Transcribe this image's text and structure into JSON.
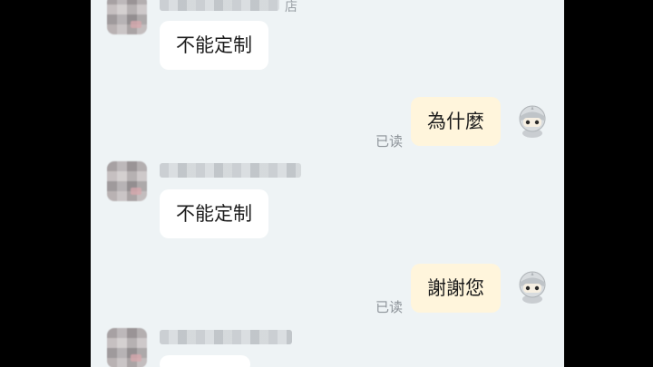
{
  "messages": [
    {
      "side": "left",
      "text": "不能定制",
      "name_suffix": "店"
    },
    {
      "side": "right",
      "text": "為什麼",
      "status": "已读"
    },
    {
      "side": "left",
      "text": "不能定制"
    },
    {
      "side": "right",
      "text": "謝謝您",
      "status": "已读"
    }
  ],
  "icons": {
    "contact_avatar": "blurred-avatar",
    "self_avatar": "knight-helmet-avatar"
  },
  "colors": {
    "background": "#eef3f5",
    "incoming_bubble": "#ffffff",
    "outgoing_bubble": "#fff5dc",
    "read_status": "#8d9399"
  }
}
